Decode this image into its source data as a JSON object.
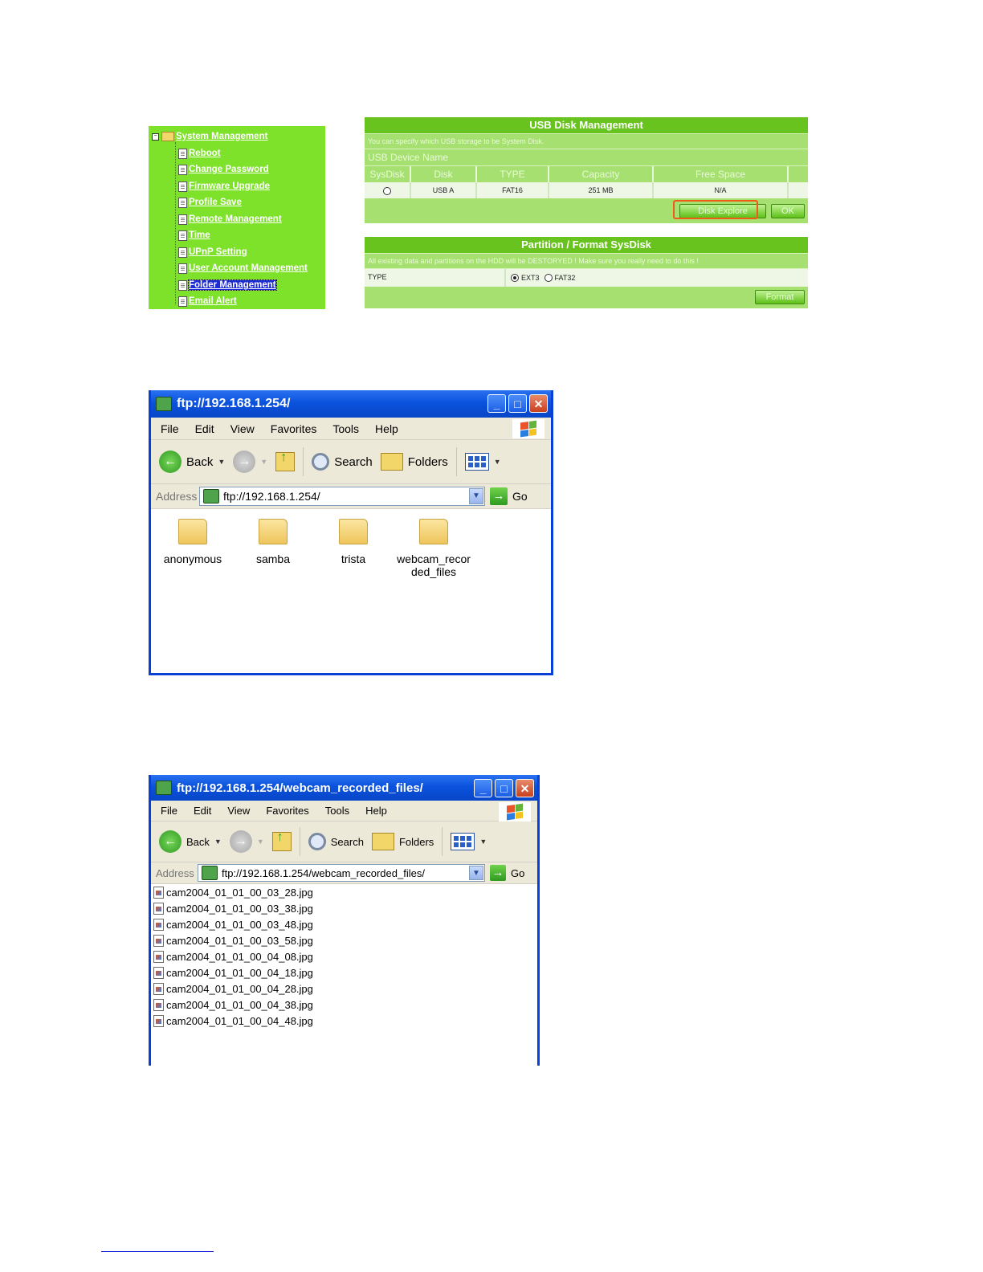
{
  "tree": {
    "root": "System Management",
    "items": [
      "Reboot",
      "Change Password",
      "Firmware Upgrade",
      "Profile Save",
      "Remote Management",
      "Time",
      "UPnP Setting",
      "User Account Management",
      "Folder Management",
      "Email Alert"
    ],
    "selected": "Folder Management"
  },
  "usb": {
    "title": "USB Disk Management",
    "desc": "You can specify which USB storage to be System Disk.",
    "device_name_label": "USB Device Name",
    "columns": [
      "SysDisk",
      "Disk",
      "TYPE",
      "Capacity",
      "Free Space"
    ],
    "row": {
      "disk": "USB A",
      "type": "FAT16",
      "capacity": "251 MB",
      "free": "N/A"
    },
    "disk_explore_label": "Disk Explore",
    "ok_label": "OK"
  },
  "partition": {
    "title": "Partition / Format SysDisk",
    "warning": "All existing data and partitions on the HDD will be DESTORYED ! Make sure you really need to do this !",
    "type_label": "TYPE",
    "options": [
      "EXT3",
      "FAT32"
    ],
    "selected": "EXT3",
    "format_label": "Format"
  },
  "window1": {
    "title": "ftp://192.168.1.254/",
    "menu": [
      "File",
      "Edit",
      "View",
      "Favorites",
      "Tools",
      "Help"
    ],
    "toolbar": {
      "back": "Back",
      "search": "Search",
      "folders": "Folders"
    },
    "address_label": "Address",
    "address": "ftp://192.168.1.254/",
    "go": "Go",
    "folders": [
      "anonymous",
      "samba",
      "trista",
      "webcam_recor ded_files"
    ]
  },
  "window2": {
    "title": "ftp://192.168.1.254/webcam_recorded_files/",
    "menu": [
      "File",
      "Edit",
      "View",
      "Favorites",
      "Tools",
      "Help"
    ],
    "toolbar": {
      "back": "Back",
      "search": "Search",
      "folders": "Folders"
    },
    "address_label": "Address",
    "address": "ftp://192.168.1.254/webcam_recorded_files/",
    "go": "Go",
    "files": [
      "cam2004_01_01_00_03_28.jpg",
      "cam2004_01_01_00_03_38.jpg",
      "cam2004_01_01_00_03_48.jpg",
      "cam2004_01_01_00_03_58.jpg",
      "cam2004_01_01_00_04_08.jpg",
      "cam2004_01_01_00_04_18.jpg",
      "cam2004_01_01_00_04_28.jpg",
      "cam2004_01_01_00_04_38.jpg",
      "cam2004_01_01_00_04_48.jpg"
    ]
  },
  "colors": {
    "menu_green": "#7ee22a",
    "header_green": "#68c31e",
    "xp_blue": "#0a52dd",
    "highlight_orange": "#f25a1a"
  }
}
